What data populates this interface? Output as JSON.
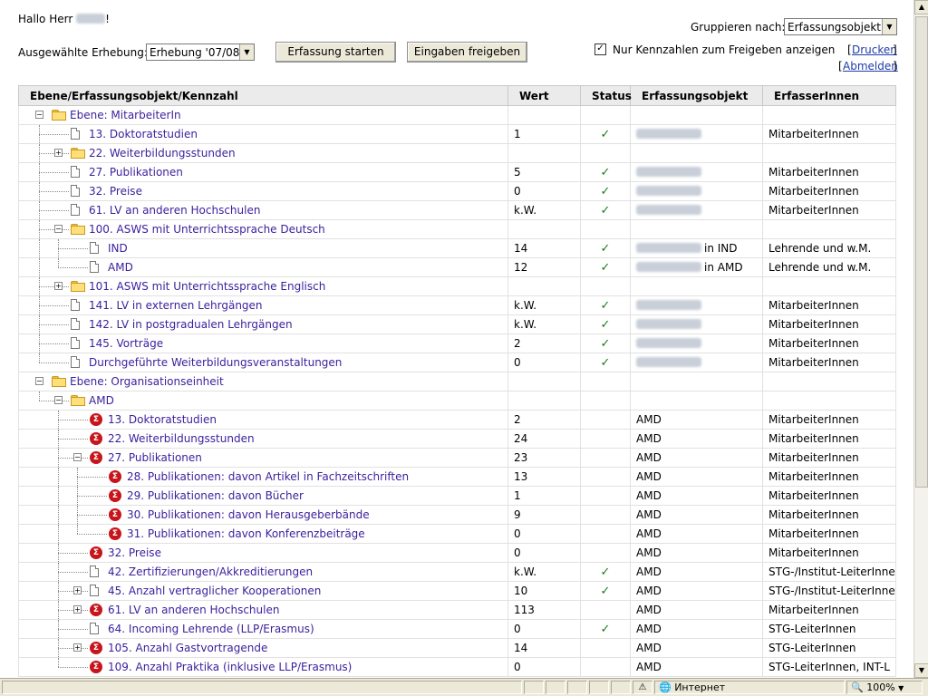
{
  "header": {
    "greeting": "Hallo Herr",
    "greeting_suffix": "!",
    "erhebung_label": "Ausgewählte Erhebung:",
    "erhebung_value": "Erhebung '07/08'",
    "btn_start": "Erfassung starten",
    "btn_release": "Eingaben freigeben",
    "group_label": "Gruppieren nach:",
    "group_value": "Erfassungsobjekt",
    "checkbox_label": "Nur Kennzahlen zum Freigeben anzeigen",
    "print_link": "Drucken",
    "logout_link": "Abmelden",
    "bracket_open": "[",
    "bracket_close": "]"
  },
  "table": {
    "columns": [
      "Ebene/Erfassungsobjekt/Kennzahl",
      "Wert",
      "Status",
      "Erfassungsobjekt",
      "ErfasserInnen"
    ],
    "rows": [
      {
        "level": 0,
        "type": "folder",
        "toggle": "minus",
        "label": "Ebene: MitarbeiterIn",
        "value": "",
        "status": "",
        "obj": "",
        "obj_suffix": "",
        "who": ""
      },
      {
        "level": 1,
        "type": "doc",
        "toggle": "",
        "label": "13. Doktoratstudien",
        "value": "1",
        "status": "✓",
        "obj": "blur",
        "obj_suffix": "",
        "who": "MitarbeiterInnen"
      },
      {
        "level": 1,
        "type": "folder",
        "toggle": "plus",
        "label": "22. Weiterbildungsstunden",
        "value": "",
        "status": "",
        "obj": "",
        "obj_suffix": "",
        "who": ""
      },
      {
        "level": 1,
        "type": "doc",
        "toggle": "",
        "label": "27. Publikationen",
        "value": "5",
        "status": "✓",
        "obj": "blur",
        "obj_suffix": "",
        "who": "MitarbeiterInnen"
      },
      {
        "level": 1,
        "type": "doc",
        "toggle": "",
        "label": "32. Preise",
        "value": "0",
        "status": "✓",
        "obj": "blur",
        "obj_suffix": "",
        "who": "MitarbeiterInnen"
      },
      {
        "level": 1,
        "type": "doc",
        "toggle": "",
        "label": "61. LV an anderen Hochschulen",
        "value": "k.W.",
        "status": "✓",
        "obj": "blur",
        "obj_suffix": "",
        "who": "MitarbeiterInnen"
      },
      {
        "level": 1,
        "type": "folder",
        "toggle": "minus",
        "label": "100. ASWS mit Unterrichtssprache Deutsch",
        "value": "",
        "status": "",
        "obj": "",
        "obj_suffix": "",
        "who": ""
      },
      {
        "level": 2,
        "type": "doc",
        "toggle": "",
        "label": "IND",
        "value": "14",
        "status": "✓",
        "obj": "blur",
        "obj_suffix": "in IND",
        "who": "Lehrende und w.M."
      },
      {
        "level": 2,
        "type": "doc",
        "toggle": "",
        "label": "AMD",
        "value": "12",
        "status": "✓",
        "obj": "blur",
        "obj_suffix": "in AMD",
        "who": "Lehrende und w.M."
      },
      {
        "level": 1,
        "type": "folder",
        "toggle": "plus",
        "label": "101. ASWS mit Unterrichtssprache Englisch",
        "value": "",
        "status": "",
        "obj": "",
        "obj_suffix": "",
        "who": ""
      },
      {
        "level": 1,
        "type": "doc",
        "toggle": "",
        "label": "141. LV in externen Lehrgängen",
        "value": "k.W.",
        "status": "✓",
        "obj": "blur",
        "obj_suffix": "",
        "who": "MitarbeiterInnen"
      },
      {
        "level": 1,
        "type": "doc",
        "toggle": "",
        "label": "142. LV in postgradualen Lehrgängen",
        "value": "k.W.",
        "status": "✓",
        "obj": "blur",
        "obj_suffix": "",
        "who": "MitarbeiterInnen"
      },
      {
        "level": 1,
        "type": "doc",
        "toggle": "",
        "label": "145. Vorträge",
        "value": "2",
        "status": "✓",
        "obj": "blur",
        "obj_suffix": "",
        "who": "MitarbeiterInnen"
      },
      {
        "level": 1,
        "type": "doc",
        "toggle": "",
        "label": "Durchgeführte Weiterbildungsveranstaltungen",
        "value": "0",
        "status": "✓",
        "obj": "blur",
        "obj_suffix": "",
        "who": "MitarbeiterInnen"
      },
      {
        "level": 0,
        "type": "folder",
        "toggle": "minus",
        "label": "Ebene: Organisationseinheit",
        "value": "",
        "status": "",
        "obj": "",
        "obj_suffix": "",
        "who": ""
      },
      {
        "level": 1,
        "type": "folder",
        "toggle": "minus",
        "label": "AMD",
        "value": "",
        "status": "",
        "obj": "",
        "obj_suffix": "",
        "who": ""
      },
      {
        "level": 2,
        "type": "sigma",
        "toggle": "",
        "label": "13. Doktoratstudien",
        "value": "2",
        "status": "",
        "obj": "AMD",
        "obj_suffix": "",
        "who": "MitarbeiterInnen"
      },
      {
        "level": 2,
        "type": "sigma",
        "toggle": "",
        "label": "22. Weiterbildungsstunden",
        "value": "24",
        "status": "",
        "obj": "AMD",
        "obj_suffix": "",
        "who": "MitarbeiterInnen"
      },
      {
        "level": 2,
        "type": "sigma",
        "toggle": "minus",
        "label": "27. Publikationen",
        "value": "23",
        "status": "",
        "obj": "AMD",
        "obj_suffix": "",
        "who": "MitarbeiterInnen"
      },
      {
        "level": 3,
        "type": "sigma",
        "toggle": "",
        "label": "28. Publikationen: davon Artikel in Fachzeitschriften",
        "value": "13",
        "status": "",
        "obj": "AMD",
        "obj_suffix": "",
        "who": "MitarbeiterInnen"
      },
      {
        "level": 3,
        "type": "sigma",
        "toggle": "",
        "label": "29. Publikationen: davon Bücher",
        "value": "1",
        "status": "",
        "obj": "AMD",
        "obj_suffix": "",
        "who": "MitarbeiterInnen"
      },
      {
        "level": 3,
        "type": "sigma",
        "toggle": "",
        "label": "30. Publikationen: davon Herausgeberbände",
        "value": "9",
        "status": "",
        "obj": "AMD",
        "obj_suffix": "",
        "who": "MitarbeiterInnen"
      },
      {
        "level": 3,
        "type": "sigma",
        "toggle": "",
        "label": "31. Publikationen: davon Konferenzbeiträge",
        "value": "0",
        "status": "",
        "obj": "AMD",
        "obj_suffix": "",
        "who": "MitarbeiterInnen"
      },
      {
        "level": 2,
        "type": "sigma",
        "toggle": "",
        "label": "32. Preise",
        "value": "0",
        "status": "",
        "obj": "AMD",
        "obj_suffix": "",
        "who": "MitarbeiterInnen"
      },
      {
        "level": 2,
        "type": "doc",
        "toggle": "",
        "label": "42. Zertifizierungen/Akkreditierungen",
        "value": "k.W.",
        "status": "✓",
        "obj": "AMD",
        "obj_suffix": "",
        "who": "STG-/Institut-LeiterInne"
      },
      {
        "level": 2,
        "type": "doc",
        "toggle": "plus",
        "label": "45. Anzahl vertraglicher Kooperationen",
        "value": "10",
        "status": "✓",
        "obj": "AMD",
        "obj_suffix": "",
        "who": "STG-/Institut-LeiterInne"
      },
      {
        "level": 2,
        "type": "sigma",
        "toggle": "plus",
        "label": "61. LV an anderen Hochschulen",
        "value": "113",
        "status": "",
        "obj": "AMD",
        "obj_suffix": "",
        "who": "MitarbeiterInnen"
      },
      {
        "level": 2,
        "type": "doc",
        "toggle": "",
        "label": "64. Incoming Lehrende (LLP/Erasmus)",
        "value": "0",
        "status": "✓",
        "obj": "AMD",
        "obj_suffix": "",
        "who": "STG-LeiterInnen"
      },
      {
        "level": 2,
        "type": "sigma",
        "toggle": "plus",
        "label": "105. Anzahl Gastvortragende",
        "value": "14",
        "status": "",
        "obj": "AMD",
        "obj_suffix": "",
        "who": "STG-LeiterInnen"
      },
      {
        "level": 2,
        "type": "sigma",
        "toggle": "",
        "label": "109. Anzahl Praktika (inklusive LLP/Erasmus)",
        "value": "0",
        "status": "",
        "obj": "AMD",
        "obj_suffix": "",
        "who": "STG-LeiterInnen, INT-L"
      }
    ]
  },
  "statusbar": {
    "zone": "Интернет",
    "zoom": "100%"
  },
  "colors": {
    "link": "#3a1f9c",
    "check": "#1b7a1b",
    "sigma": "#c8141b"
  }
}
